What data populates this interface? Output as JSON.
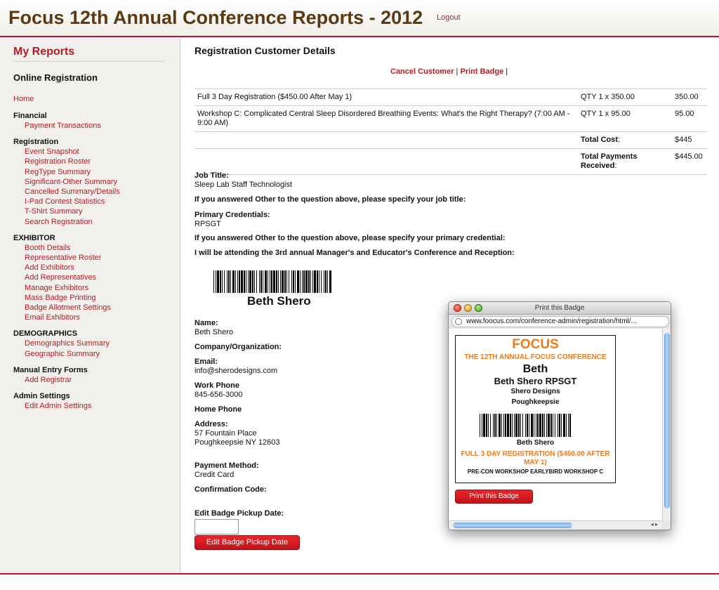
{
  "header": {
    "title": "Focus 12th Annual Conference Reports - 2012",
    "logout": "Logout"
  },
  "sidebar": {
    "my_reports": "My Reports",
    "online_registration": "Online Registration",
    "home": "Home",
    "sections": [
      {
        "title": "Financial",
        "links": [
          "Payment Transactions"
        ]
      },
      {
        "title": "Registration",
        "links": [
          "Event Snapshot",
          "Registration Roster",
          "RegType Summary",
          "Significant-Other Summary",
          "Cancelled Summary/Details",
          "I-Pad Contest Statistics",
          "T-Shirt Summary",
          "Search Registration"
        ]
      },
      {
        "title": "EXHIBITOR",
        "links": [
          "Booth Details",
          "Representative Roster",
          "Add Exhibitors",
          "Add Representatives",
          "Manage Exhibitors",
          "Mass Badge Printing",
          "Badge Allotment Settings",
          "Email Exhibitors"
        ]
      },
      {
        "title": "DEMOGRAPHICS",
        "links": [
          "Demographics Summary",
          "Geographic Summary"
        ]
      },
      {
        "title": "Manual Entry Forms",
        "links": [
          "Add Registrar"
        ]
      },
      {
        "title": "Admin Settings",
        "links": [
          "Edit Admin Settings"
        ]
      }
    ]
  },
  "main": {
    "heading": "Registration Customer Details",
    "cancel_customer": "Cancel Customer",
    "print_badge": "Print Badge",
    "sep": "|",
    "orders": [
      {
        "item": "Full 3 Day Registration ($450.00 After May 1)",
        "qty": "QTY 1 x 350.00",
        "amount": "350.00"
      },
      {
        "item": "Workshop C: Complicated Central Sleep Disordered Breathing Events: What's the Right Therapy? (7:00 AM - 9:00 AM)",
        "qty": "QTY 1 x 95.00",
        "amount": "95.00"
      }
    ],
    "total_cost_label": "Total Cost",
    "total_cost": "$445",
    "total_payments_label": "Total Payments Received",
    "total_payments": "$445.00",
    "job_title_label": "Job Title:",
    "job_title": "Sleep Lab Staff Technologist",
    "other_job_q": "If you answered Other to the question above, please specify your job title:",
    "primary_cred_label": "Primary Credentials:",
    "primary_cred": "RPSGT",
    "other_cred_q": "If you answered Other to the question above, please specify your primary credential:",
    "attending_q": "I will be attending the 3rd annual Manager's and Educator's Conference and Reception:",
    "barcode_name": "Beth Shero",
    "name_label": "Name:",
    "name": "Beth Shero",
    "company_label": "Company/Organization:",
    "email_label": "Email:",
    "email": "info@sherodesigns.com",
    "work_phone_label": "Work Phone",
    "work_phone": "845-656-3000",
    "home_phone_label": "Home Phone",
    "address_label": "Address:",
    "address_line1": "57 Fountain Place",
    "address_line2": "Poughkeepsie NY 12603",
    "payment_method_label": "Payment Method:",
    "payment_method": "Credit Card",
    "confirmation_label": "Confirmation Code:",
    "edit_badge_label": "Edit Badge Pickup Date:",
    "edit_badge_value": "",
    "edit_badge_button": "Edit Badge Pickup Date"
  },
  "popup": {
    "window_title": "Print this Badge",
    "url": "www.foocus.com/conference-admin/registration/html/...",
    "badge": {
      "focus": "FOCUS",
      "conference": "THE 12TH ANNUAL FOCUS CONFERENCE",
      "first_name": "Beth",
      "full_name": "Beth Shero RPSGT",
      "company": "Shero Designs",
      "city": "Poughkeepsie",
      "barcode_name": "Beth Shero",
      "registration": "FULL 3 DAY REGISTRATION ($450.00 AFTER MAY 1)",
      "workshops": "PRE-CON WORKSHOP EARLYBIRD WORKSHOP C"
    },
    "print_button": "Print this Badge"
  },
  "colors": {
    "brand_red": "#b31c22",
    "title_brown": "#5a3a12",
    "badge_orange": "#ee7a1b"
  }
}
